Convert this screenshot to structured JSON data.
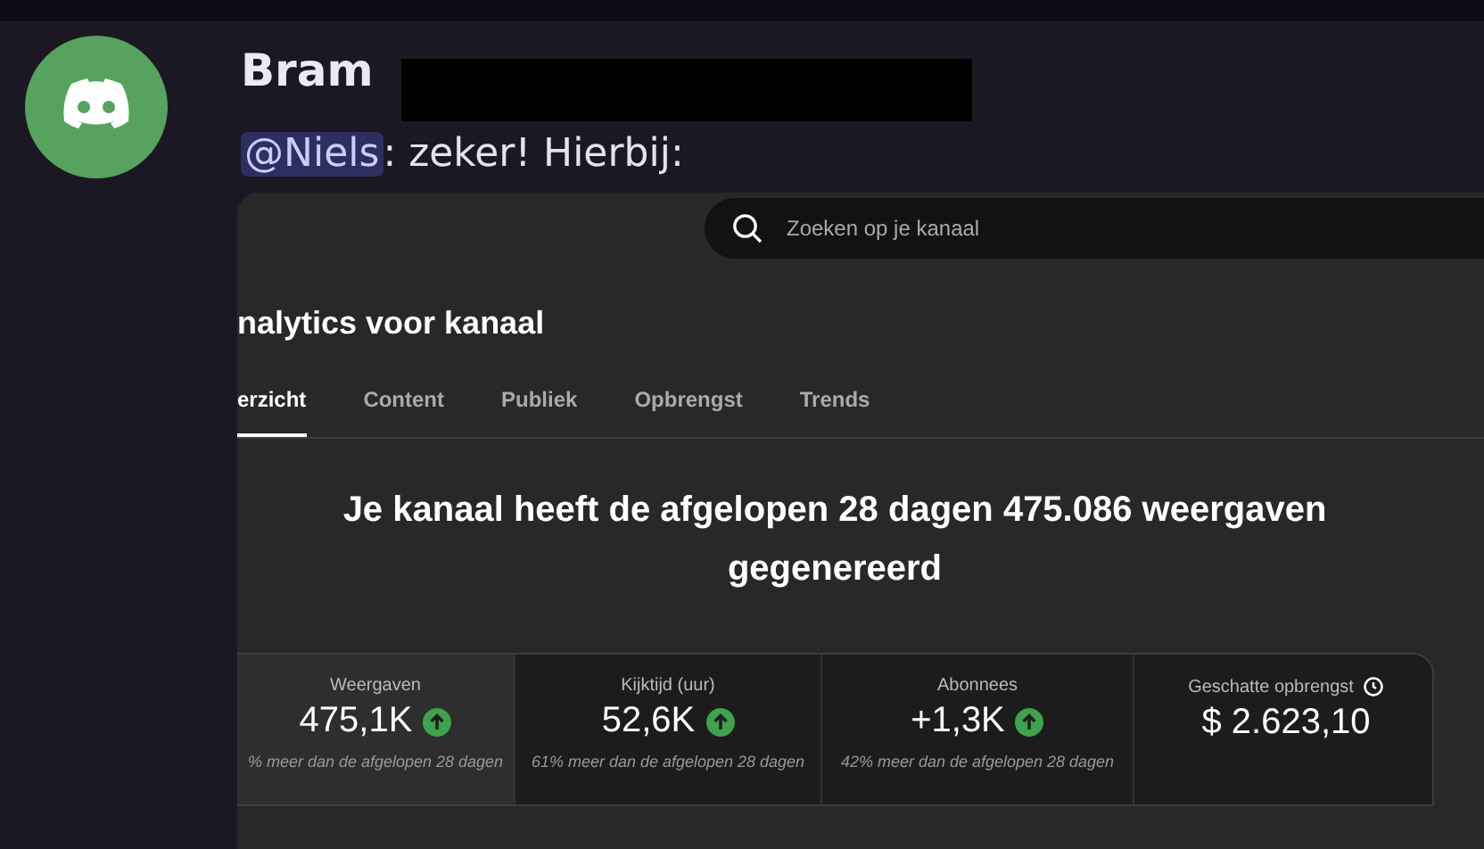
{
  "message": {
    "author": "Bram",
    "mention": "@Niels",
    "text": ": zeker! Hierbij:",
    "redacted": true
  },
  "screenshot": {
    "search": {
      "placeholder": "Zoeken op je kanaal"
    },
    "title": "nalytics voor kanaal",
    "tabs": [
      {
        "label": "erzicht",
        "selected": true
      },
      {
        "label": "Content",
        "selected": false
      },
      {
        "label": "Publiek",
        "selected": false
      },
      {
        "label": "Opbrengst",
        "selected": false
      },
      {
        "label": "Trends",
        "selected": false
      }
    ],
    "headline": "Je kanaal heeft de afgelopen 28 dagen 475.086 weergaven gegenereerd",
    "cards": [
      {
        "kind": "metric",
        "label": "Weergaven",
        "value": "475,1K",
        "trend_up": true,
        "comparison": "% meer dan de afgelopen 28 dagen",
        "selected": true
      },
      {
        "kind": "metric",
        "label": "Kijktijd (uur)",
        "value": "52,6K",
        "trend_up": true,
        "comparison": "61% meer dan de afgelopen 28 dagen",
        "selected": false
      },
      {
        "kind": "metric",
        "label": "Abonnees",
        "value": "+1,3K",
        "trend_up": true,
        "comparison": "42% meer dan de afgelopen 28 dagen",
        "selected": false
      },
      {
        "kind": "estimate",
        "label": "Geschatte opbrengst",
        "value": "$ 2.623,10",
        "trend_up": false,
        "selected": false
      }
    ]
  }
}
